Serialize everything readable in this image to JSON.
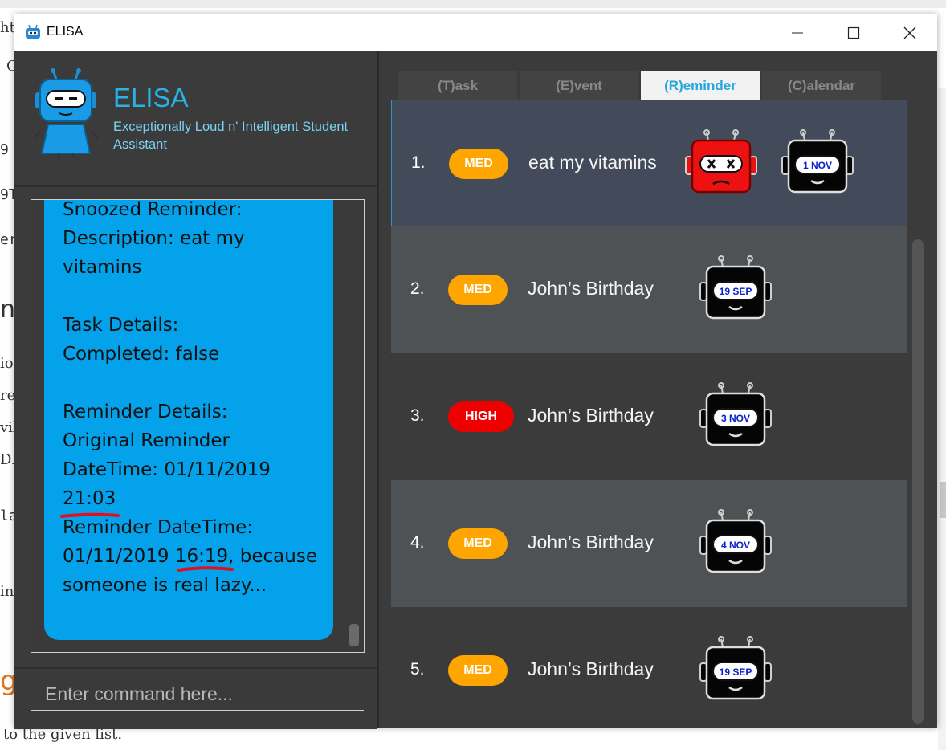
{
  "window": {
    "title": "ELISA",
    "minimize_glyph": "—",
    "maximize_glyph": "☐",
    "close_glyph": "✕"
  },
  "background_page": {
    "frag_ht": "ht",
    "frag_c": "C",
    "frag_9": "9",
    "frag_9t": "9T",
    "frag_er": "er",
    "frag_n": "n",
    "frag_io": "io",
    "frag_re": "re",
    "frag_vi": "vil",
    "frag_on": "DN",
    "frag_la": "la",
    "frag_in": "in",
    "frag_g": "g",
    "bottom_text": "to the given list."
  },
  "brand": {
    "name": "ELISA",
    "tagline": "Exceptionally Loud n' Intelligent Student Assistant"
  },
  "chat": {
    "message": "Snoozed Reminder:\nDescription: eat my vitamins\n\nTask Details:\nCompleted: false\n\nReminder Details:\nOriginal Reminder DateTime: 01/11/2019 21:03\nReminder DateTime: 01/11/2019 16:19, because someone is real lazy..."
  },
  "command": {
    "placeholder": "Enter command here..."
  },
  "tabs": [
    {
      "label": "(T)ask",
      "active": false
    },
    {
      "label": "(E)vent",
      "active": false
    },
    {
      "label": "(R)eminder",
      "active": true
    },
    {
      "label": "(C)alendar",
      "active": false
    }
  ],
  "reminders": [
    {
      "index": "1.",
      "priority": "MED",
      "description": "eat my vitamins",
      "snoozed": true,
      "date": "1 NOV"
    },
    {
      "index": "2.",
      "priority": "MED",
      "description": "John’s Birthday",
      "snoozed": false,
      "date": "19 SEP"
    },
    {
      "index": "3.",
      "priority": "HIGH",
      "description": "John’s Birthday",
      "snoozed": false,
      "date": "3 NOV"
    },
    {
      "index": "4.",
      "priority": "MED",
      "description": "John’s Birthday",
      "snoozed": false,
      "date": "4 NOV"
    },
    {
      "index": "5.",
      "priority": "MED",
      "description": "John’s Birthday",
      "snoozed": false,
      "date": "19 SEP"
    }
  ],
  "colors": {
    "med": "#ffa500",
    "high": "#ee0000",
    "selected_row": "#434b5a",
    "row_light": "#4f5254",
    "row_dark": "#3b3b3b",
    "accent": "#27b3e6"
  }
}
